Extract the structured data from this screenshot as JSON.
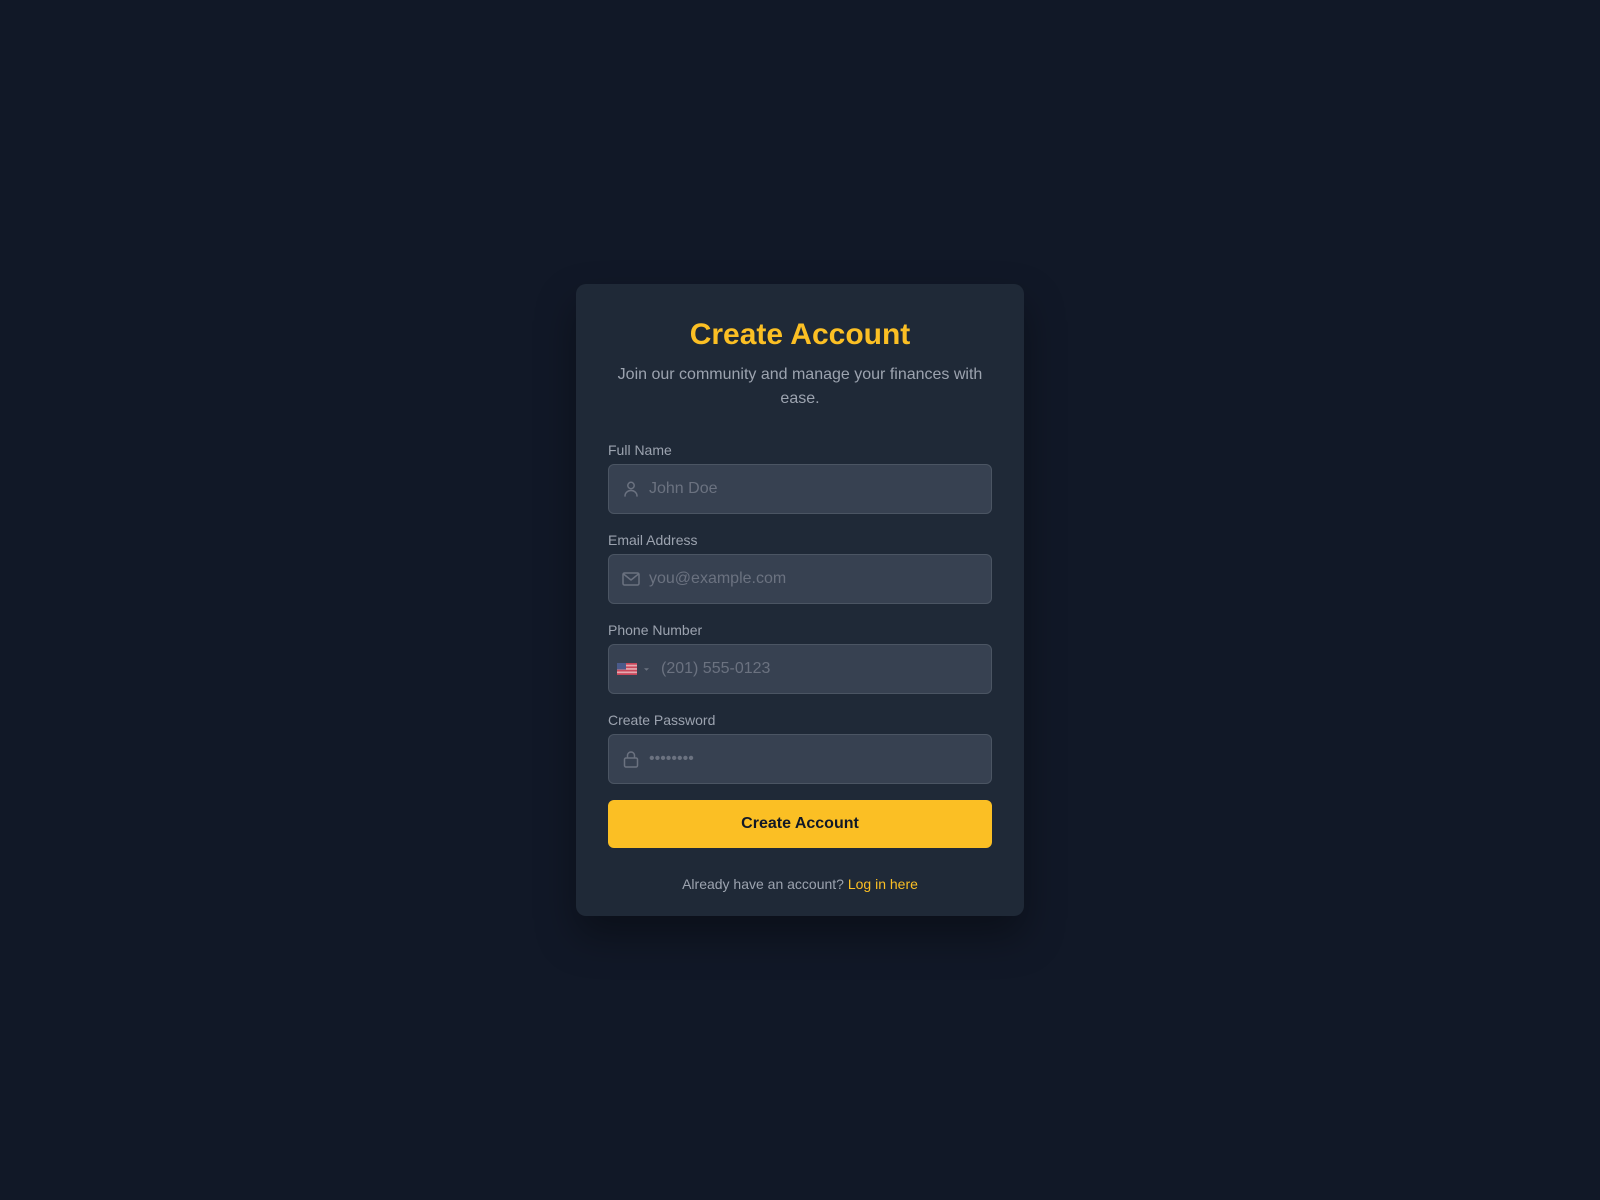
{
  "card": {
    "title": "Create Account",
    "subtitle": "Join our community and manage your finances with ease."
  },
  "fields": {
    "full_name": {
      "label": "Full Name",
      "placeholder": "John Doe",
      "icon": "user-icon"
    },
    "email": {
      "label": "Email Address",
      "placeholder": "you@example.com",
      "icon": "mail-icon"
    },
    "phone": {
      "label": "Phone Number",
      "placeholder": "(201) 555-0123",
      "country_icon": "us-flag-icon"
    },
    "password": {
      "label": "Create Password",
      "placeholder": "••••••••",
      "icon": "lock-icon"
    }
  },
  "submit": {
    "label": "Create Account"
  },
  "footer": {
    "text": "Already have an account?",
    "link": "Log in here"
  },
  "colors": {
    "background": "#111827",
    "card": "#1f2937",
    "input": "#374151",
    "accent": "#fbbf24",
    "muted_text": "#9ca3af"
  }
}
